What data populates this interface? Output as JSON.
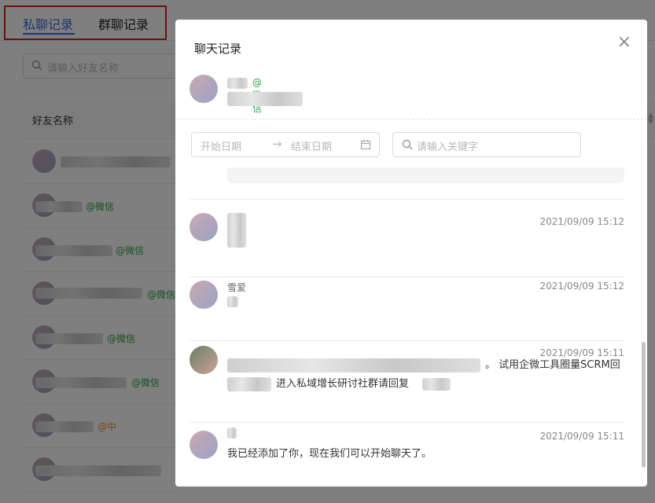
{
  "tabs": {
    "private": "私聊记录",
    "group": "群聊记录"
  },
  "bg": {
    "search_placeholder": "请输入好友名称",
    "column_friend_name": "好友名称",
    "rows": [
      {
        "tag": ""
      },
      {
        "tag": "@微信"
      },
      {
        "tag": "@微信"
      },
      {
        "tag": "@微信"
      },
      {
        "tag": "@微信"
      },
      {
        "tag": "@微信"
      },
      {
        "tag": "@中"
      },
      {
        "tag": ""
      }
    ]
  },
  "modal": {
    "title": "聊天记录",
    "close": "×",
    "contact_tag": "@微信",
    "date_start_placeholder": "开始日期",
    "date_arrow": "→",
    "date_end_placeholder": "结束日期",
    "keyword_placeholder": "请输入关键字",
    "messages": [
      {
        "name": "",
        "time": "2021/09/09 15:12",
        "text": ""
      },
      {
        "name": "雪爱",
        "time": "2021/09/09 15:12",
        "text": ""
      },
      {
        "name": "",
        "time": "2021/09/09 15:11",
        "text": "。 试用企微工具圈量SCRM回",
        "text2": "进入私域增长研讨社群请回复"
      },
      {
        "name": "",
        "time": "2021/09/09 15:11",
        "text": "我已经添加了你，现在我们可以开始聊天了。"
      }
    ]
  }
}
